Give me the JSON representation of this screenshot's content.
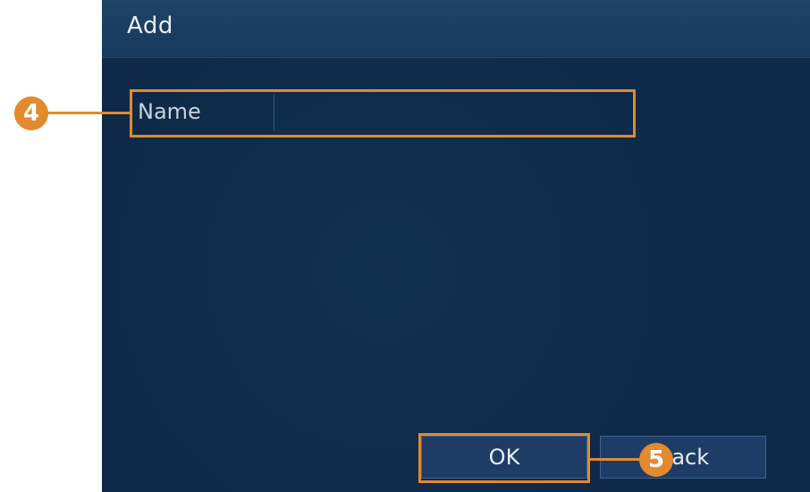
{
  "dialog": {
    "title": "Add",
    "name_field": {
      "label": "Name",
      "value": ""
    },
    "buttons": {
      "ok_label": "OK",
      "back_label": "Back"
    }
  },
  "annotations": {
    "callout_name": "4",
    "callout_ok": "5",
    "accent_color": "#e28a2d"
  },
  "colors": {
    "dialog_bg": "#0e2a48",
    "titlebar_bg": "#1e4468",
    "button_bg": "#1e3d66"
  }
}
